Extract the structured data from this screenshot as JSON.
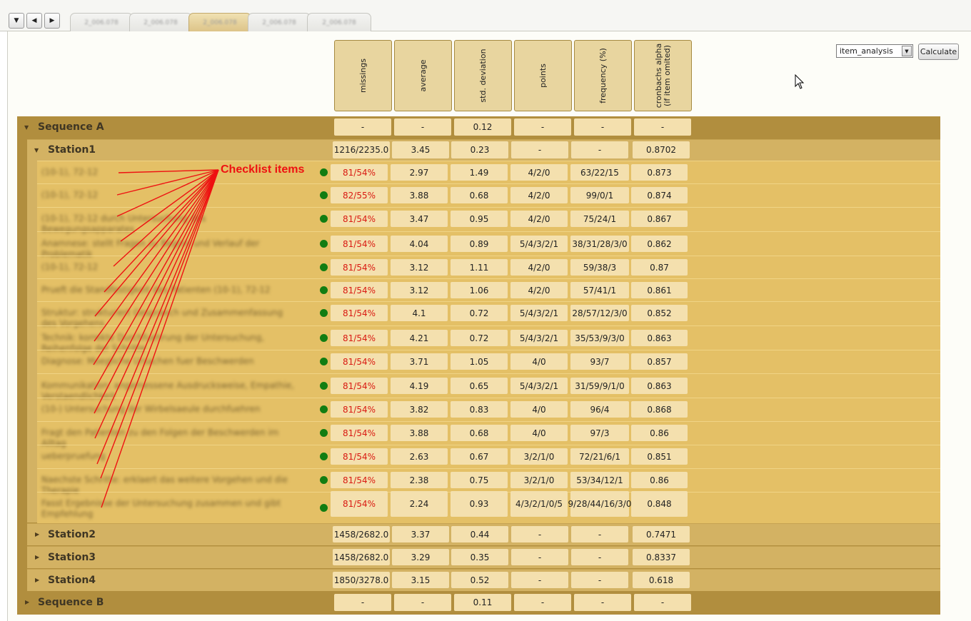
{
  "tabs": [
    "2_006.078",
    "2_006.078",
    "2_006.078",
    "2_006.078",
    "2_006.078"
  ],
  "controls": {
    "method_value": "item_analysis",
    "calculate_label": "Calculate"
  },
  "columns": [
    "missings",
    "average",
    "std. deviation",
    "points",
    "frequency (%)",
    "cronbachs alpha (if item omited)"
  ],
  "annotation": "Checklist items",
  "sequence_a": {
    "label": "Sequence A",
    "values": [
      "-",
      "-",
      "0.12",
      "-",
      "-",
      "-"
    ]
  },
  "station1": {
    "label": "Station1",
    "values": [
      "1216/2235.0",
      "3.45",
      "0.23",
      "-",
      "-",
      "0.8702"
    ]
  },
  "items": [
    {
      "text": "(10-1), 72-12",
      "missings": "81/54%",
      "average": "2.97",
      "std": "1.49",
      "points": "4/2/0",
      "frequency": "63/22/15",
      "alpha": "0.873"
    },
    {
      "text": "(10-1), 72-12",
      "missings": "82/55%",
      "average": "3.88",
      "std": "0.68",
      "points": "4/2/0",
      "frequency": "99/0/1",
      "alpha": "0.874"
    },
    {
      "text": "(10-1), 72-12 durch Untersuchung des Bewegungsapparates",
      "missings": "81/54%",
      "average": "3.47",
      "std": "0.95",
      "points": "4/2/0",
      "frequency": "75/24/1",
      "alpha": "0.867"
    },
    {
      "text": "Anamnese: stellt Fragen zu Beginn und Verlauf der Problematik",
      "missings": "81/54%",
      "average": "4.04",
      "std": "0.89",
      "points": "5/4/3/2/1",
      "frequency": "38/31/28/3/0",
      "alpha": "0.862"
    },
    {
      "text": "(10-1), 72-12",
      "missings": "81/54%",
      "average": "3.12",
      "std": "1.11",
      "points": "4/2/0",
      "frequency": "59/38/3",
      "alpha": "0.87"
    },
    {
      "text": "Prueft die Standfestigkeit des Patienten (10-1), 72-12",
      "missings": "81/54%",
      "average": "3.12",
      "std": "1.06",
      "points": "4/2/0",
      "frequency": "57/41/1",
      "alpha": "0.861"
    },
    {
      "text": "Struktur: strukturiert Gespraech und Zusammenfassung des Vorgehens",
      "missings": "81/54%",
      "average": "4.1",
      "std": "0.72",
      "points": "5/4/3/2/1",
      "frequency": "28/57/12/3/0",
      "alpha": "0.852"
    },
    {
      "text": "Technik: korrekte Durchfuehrung der Untersuchung, Reihenfolge der Schritte",
      "missings": "81/54%",
      "average": "4.21",
      "std": "0.72",
      "points": "5/4/3/2/1",
      "frequency": "35/53/9/3/0",
      "alpha": "0.863"
    },
    {
      "text": "Diagnose: Moegliche Ursachen fuer Beschwerden",
      "missings": "81/54%",
      "average": "3.71",
      "std": "1.05",
      "points": "4/0",
      "frequency": "93/7",
      "alpha": "0.857"
    },
    {
      "text": "Kommunikation: angemessene Ausdrucksweise, Empathie, Verstaendlichkeit",
      "missings": "81/54%",
      "average": "4.19",
      "std": "0.65",
      "points": "5/4/3/2/1",
      "frequency": "31/59/9/1/0",
      "alpha": "0.863"
    },
    {
      "text": "(10-) Untersuchung der Wirbelsaeule durchfuehren",
      "missings": "81/54%",
      "average": "3.82",
      "std": "0.83",
      "points": "4/0",
      "frequency": "96/4",
      "alpha": "0.868"
    },
    {
      "text": "Fragt den Patienten zu den Folgen der Beschwerden im Alltag",
      "missings": "81/54%",
      "average": "3.88",
      "std": "0.68",
      "points": "4/0",
      "frequency": "97/3",
      "alpha": "0.86"
    },
    {
      "text": "ueberpruefung",
      "missings": "81/54%",
      "average": "2.63",
      "std": "0.67",
      "points": "3/2/1/0",
      "frequency": "72/21/6/1",
      "alpha": "0.851"
    },
    {
      "text": "Naechste Schritte: erklaert das weitere Vorgehen und die Therapie",
      "missings": "81/54%",
      "average": "2.38",
      "std": "0.75",
      "points": "3/2/1/0",
      "frequency": "53/34/12/1",
      "alpha": "0.86"
    },
    {
      "text": "Fasst Ergebnisse der Untersuchung zusammen und gibt Empfehlung",
      "missings": "81/54%",
      "average": "2.24",
      "std": "0.93",
      "points": "4/3/2/1/0/5",
      "frequency": "9/28/44/16/3/0",
      "alpha": "0.848"
    }
  ],
  "stations": [
    {
      "label": "Station2",
      "values": [
        "1458/2682.0",
        "3.37",
        "0.44",
        "-",
        "-",
        "0.7471"
      ]
    },
    {
      "label": "Station3",
      "values": [
        "1458/2682.0",
        "3.29",
        "0.35",
        "-",
        "-",
        "0.8337"
      ]
    },
    {
      "label": "Station4",
      "values": [
        "1850/3278.0",
        "3.15",
        "0.52",
        "-",
        "-",
        "0.618"
      ]
    }
  ],
  "sequence_b": {
    "label": "Sequence B",
    "values": [
      "-",
      "-",
      "0.11",
      "-",
      "-",
      "-"
    ]
  },
  "colors": {
    "sequence_bg": "#b18e3e",
    "station_bg": "#d3b263",
    "item_bg": "#e4c066",
    "cell_bg": "#f4e0ae",
    "status_dot": "#127d12",
    "missing_text": "#d91a12",
    "annotation": "#ee1111"
  },
  "icons": {
    "expanded": "triangle-down-icon",
    "collapsed": "triangle-right-icon",
    "status": "green-dot-icon",
    "cursor": "mouse-pointer-icon"
  }
}
